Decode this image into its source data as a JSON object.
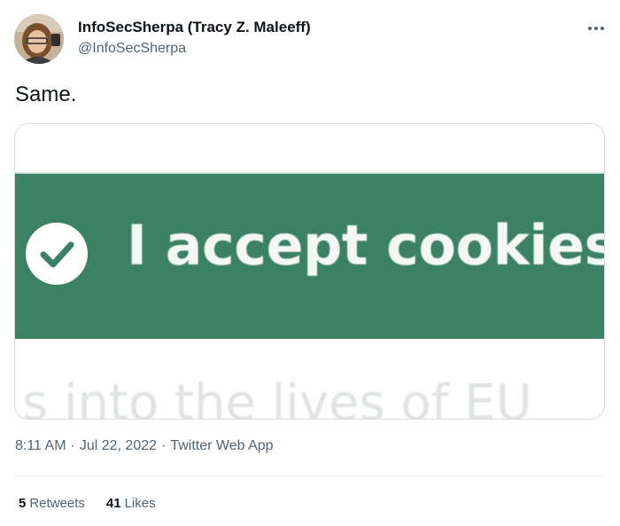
{
  "author": {
    "display_name": "InfoSecSherpa (Tracy Z. Maleeff)",
    "handle": "@InfoSecSherpa"
  },
  "tweet": {
    "text": "Same."
  },
  "media": {
    "banner_text": "I accept cookies",
    "partial_text_below": "s into the lives of EU",
    "banner_color": "#3b8166"
  },
  "meta": {
    "time": "8:11 AM",
    "date": "Jul 22, 2022",
    "source": "Twitter Web App",
    "separator": "·"
  },
  "stats": {
    "retweets_count": "5",
    "retweets_label": "Retweets",
    "likes_count": "41",
    "likes_label": "Likes"
  },
  "icons": {
    "more": "more-dots-icon",
    "check": "check-circle-icon"
  }
}
